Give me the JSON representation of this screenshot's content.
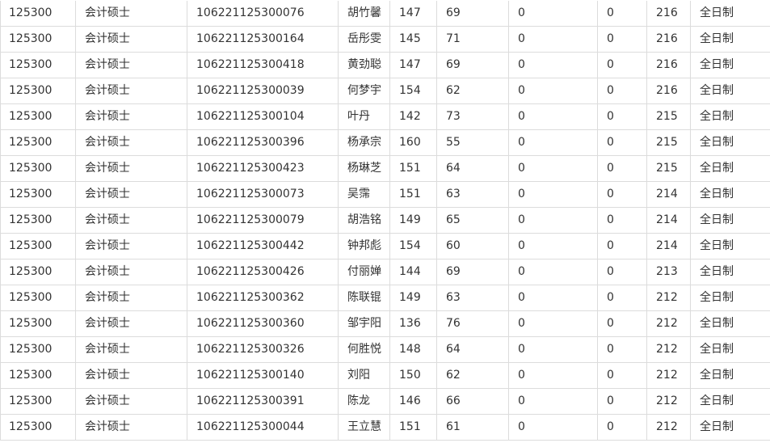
{
  "table": {
    "rows": [
      [
        "125300",
        "会计硕士",
        "106221125300076",
        "胡竹馨",
        "147",
        "69",
        "0",
        "0",
        "216",
        "全日制"
      ],
      [
        "125300",
        "会计硕士",
        "106221125300164",
        "岳彤雯",
        "145",
        "71",
        "0",
        "0",
        "216",
        "全日制"
      ],
      [
        "125300",
        "会计硕士",
        "106221125300418",
        "黄劲聪",
        "147",
        "69",
        "0",
        "0",
        "216",
        "全日制"
      ],
      [
        "125300",
        "会计硕士",
        "106221125300039",
        "何梦宇",
        "154",
        "62",
        "0",
        "0",
        "216",
        "全日制"
      ],
      [
        "125300",
        "会计硕士",
        "106221125300104",
        "叶丹",
        "142",
        "73",
        "0",
        "0",
        "215",
        "全日制"
      ],
      [
        "125300",
        "会计硕士",
        "106221125300396",
        "杨承宗",
        "160",
        "55",
        "0",
        "0",
        "215",
        "全日制"
      ],
      [
        "125300",
        "会计硕士",
        "106221125300423",
        "杨琳芝",
        "151",
        "64",
        "0",
        "0",
        "215",
        "全日制"
      ],
      [
        "125300",
        "会计硕士",
        "106221125300073",
        "吴霈",
        "151",
        "63",
        "0",
        "0",
        "214",
        "全日制"
      ],
      [
        "125300",
        "会计硕士",
        "106221125300079",
        "胡浩铭",
        "149",
        "65",
        "0",
        "0",
        "214",
        "全日制"
      ],
      [
        "125300",
        "会计硕士",
        "106221125300442",
        "钟邦彪",
        "154",
        "60",
        "0",
        "0",
        "214",
        "全日制"
      ],
      [
        "125300",
        "会计硕士",
        "106221125300426",
        "付丽婵",
        "144",
        "69",
        "0",
        "0",
        "213",
        "全日制"
      ],
      [
        "125300",
        "会计硕士",
        "106221125300362",
        "陈联锟",
        "149",
        "63",
        "0",
        "0",
        "212",
        "全日制"
      ],
      [
        "125300",
        "会计硕士",
        "106221125300360",
        "邹宇阳",
        "136",
        "76",
        "0",
        "0",
        "212",
        "全日制"
      ],
      [
        "125300",
        "会计硕士",
        "106221125300326",
        "何胜悦",
        "148",
        "64",
        "0",
        "0",
        "212",
        "全日制"
      ],
      [
        "125300",
        "会计硕士",
        "106221125300140",
        "刘阳",
        "150",
        "62",
        "0",
        "0",
        "212",
        "全日制"
      ],
      [
        "125300",
        "会计硕士",
        "106221125300391",
        "陈龙",
        "146",
        "66",
        "0",
        "0",
        "212",
        "全日制"
      ],
      [
        "125300",
        "会计硕士",
        "106221125300044",
        "王立慧",
        "151",
        "61",
        "0",
        "0",
        "212",
        "全日制"
      ]
    ]
  }
}
